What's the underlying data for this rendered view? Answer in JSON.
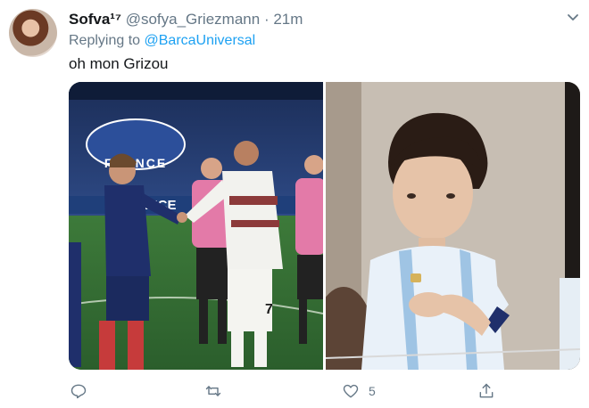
{
  "tweet": {
    "display_name": "Sofva¹⁷",
    "handle": "@sofya_Griezmann",
    "separator": "·",
    "timestamp": "21m",
    "replying_prefix": "Replying to",
    "replying_to": "@BarcaUniversal",
    "text": "oh mon Grizou"
  },
  "media": {
    "left_photo": {
      "banner_text": "FRANCE",
      "stadium_logo_text": "FRANCE",
      "jersey_number": "7"
    }
  },
  "actions": {
    "reply": {
      "icon": "reply-icon",
      "count": ""
    },
    "retweet": {
      "icon": "retweet-icon",
      "count": ""
    },
    "like": {
      "icon": "heart-icon",
      "count": "5"
    },
    "share": {
      "icon": "share-icon",
      "count": ""
    }
  },
  "colors": {
    "link": "#1da1f2",
    "secondary_text": "#657786",
    "primary_text": "#14171a"
  }
}
